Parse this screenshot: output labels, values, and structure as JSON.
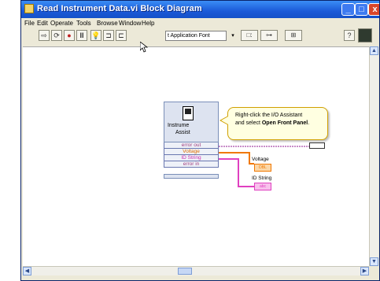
{
  "window": {
    "title": "Read Instrument Data.vi Block Diagram",
    "min_glyph": "_",
    "max_glyph": "□",
    "close_glyph": "x"
  },
  "menu": [
    "File",
    "Edit",
    "Operate",
    "Tools",
    "Browse",
    "Window",
    "Help"
  ],
  "toolbar": {
    "font_select": "t Application Font",
    "run_arrow": "⇨",
    "run_continuous": "⟳",
    "abort": "●",
    "pause": "II",
    "highlight": "💡",
    "retain": "⊐",
    "step": "⊏",
    "dd": "▾",
    "align_icon": "□:",
    "distribute_icon": "⊶",
    "reorder_icon": "⊞",
    "help_icon": "?"
  },
  "express_vi": {
    "label_line1": "Instrume",
    "label_line2": "Assist",
    "terminals": [
      "error out",
      "Voltage",
      "ID String",
      "error in"
    ]
  },
  "callout": {
    "line1": "Right-click the I/O Assistant",
    "line2_prefix": "and select ",
    "line2_bold": "Open Front Panel",
    "line2_suffix": "."
  },
  "indicators": {
    "voltage_label": "Voltage",
    "voltage_value": "DBL",
    "id_string_label": "ID String",
    "id_string_value": "abc"
  },
  "colors": {
    "title_bar": "#1b5ad8",
    "error_wire": "#c88cc8",
    "voltage_wire": "#f07800",
    "string_wire": "#e040c0",
    "callout_bg": "#ffffe1"
  }
}
